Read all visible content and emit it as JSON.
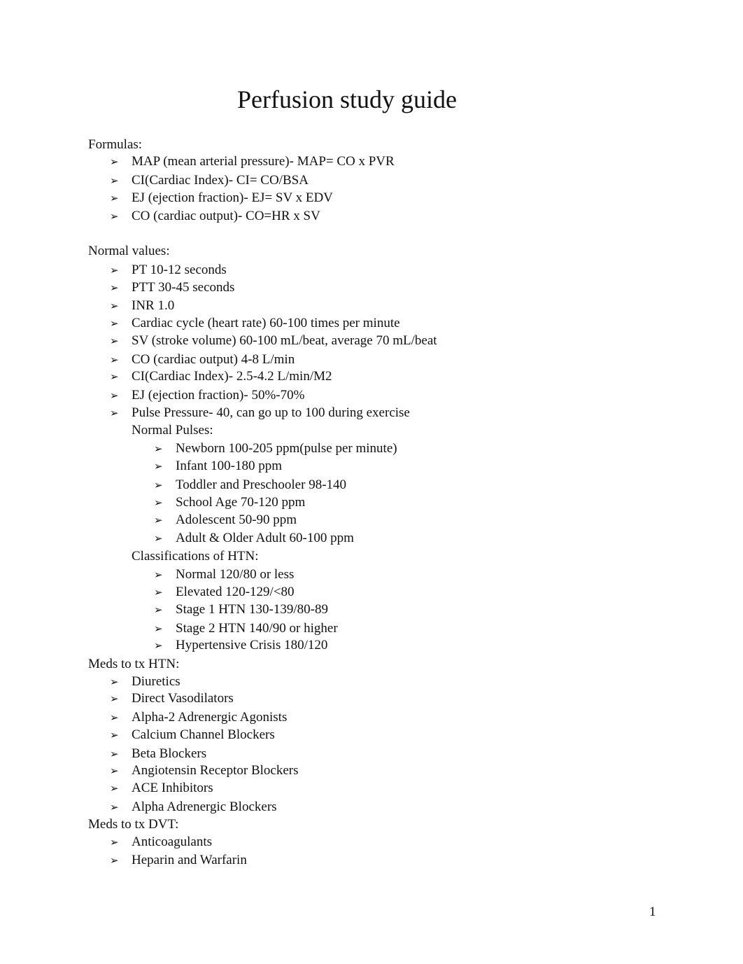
{
  "document": {
    "title": "Perfusion study guide",
    "page_number": "1",
    "bullet_glyph": "➢",
    "sections": [
      {
        "heading": "Formulas:",
        "items": [
          "MAP (mean arterial pressure)- MAP= CO x PVR",
          "CI(Cardiac Index)- CI= CO/BSA",
          "EJ (ejection fraction)- EJ= SV x EDV",
          "CO (cardiac output)- CO=HR x SV"
        ]
      },
      {
        "heading": "Normal values:",
        "items": [
          "PT 10-12 seconds",
          "PTT 30-45 seconds",
          "INR 1.0",
          "Cardiac cycle (heart rate) 60-100 times per minute",
          "SV (stroke volume) 60-100 mL/beat, average 70 mL/beat",
          "CO (cardiac output) 4-8 L/min",
          "CI(Cardiac Index)- 2.5-4.2 L/min/M2",
          "EJ (ejection fraction)- 50%-70%",
          "Pulse Pressure- 40, can go up to 100 during exercise"
        ],
        "subsections": [
          {
            "heading": "Normal Pulses:",
            "items": [
              "Newborn 100-205 ppm(pulse per minute)",
              "Infant 100-180 ppm",
              "Toddler and Preschooler 98-140",
              "School Age 70-120 ppm",
              "Adolescent 50-90 ppm",
              "Adult & Older Adult 60-100 ppm"
            ]
          },
          {
            "heading": "Classifications of HTN:",
            "items": [
              "Normal 120/80 or less",
              "Elevated 120-129/<80",
              "Stage 1 HTN 130-139/80-89",
              "Stage 2 HTN 140/90 or higher",
              "Hypertensive Crisis 180/120"
            ]
          }
        ]
      },
      {
        "heading": "Meds to tx HTN:",
        "items": [
          "Diuretics",
          "Direct Vasodilators",
          "Alpha-2 Adrenergic Agonists",
          "Calcium Channel Blockers",
          "Beta Blockers",
          "Angiotensin Receptor Blockers",
          "ACE Inhibitors",
          "Alpha Adrenergic Blockers"
        ]
      },
      {
        "heading": "Meds to tx DVT:",
        "items": [
          "Anticoagulants",
          "Heparin and Warfarin"
        ]
      }
    ]
  }
}
